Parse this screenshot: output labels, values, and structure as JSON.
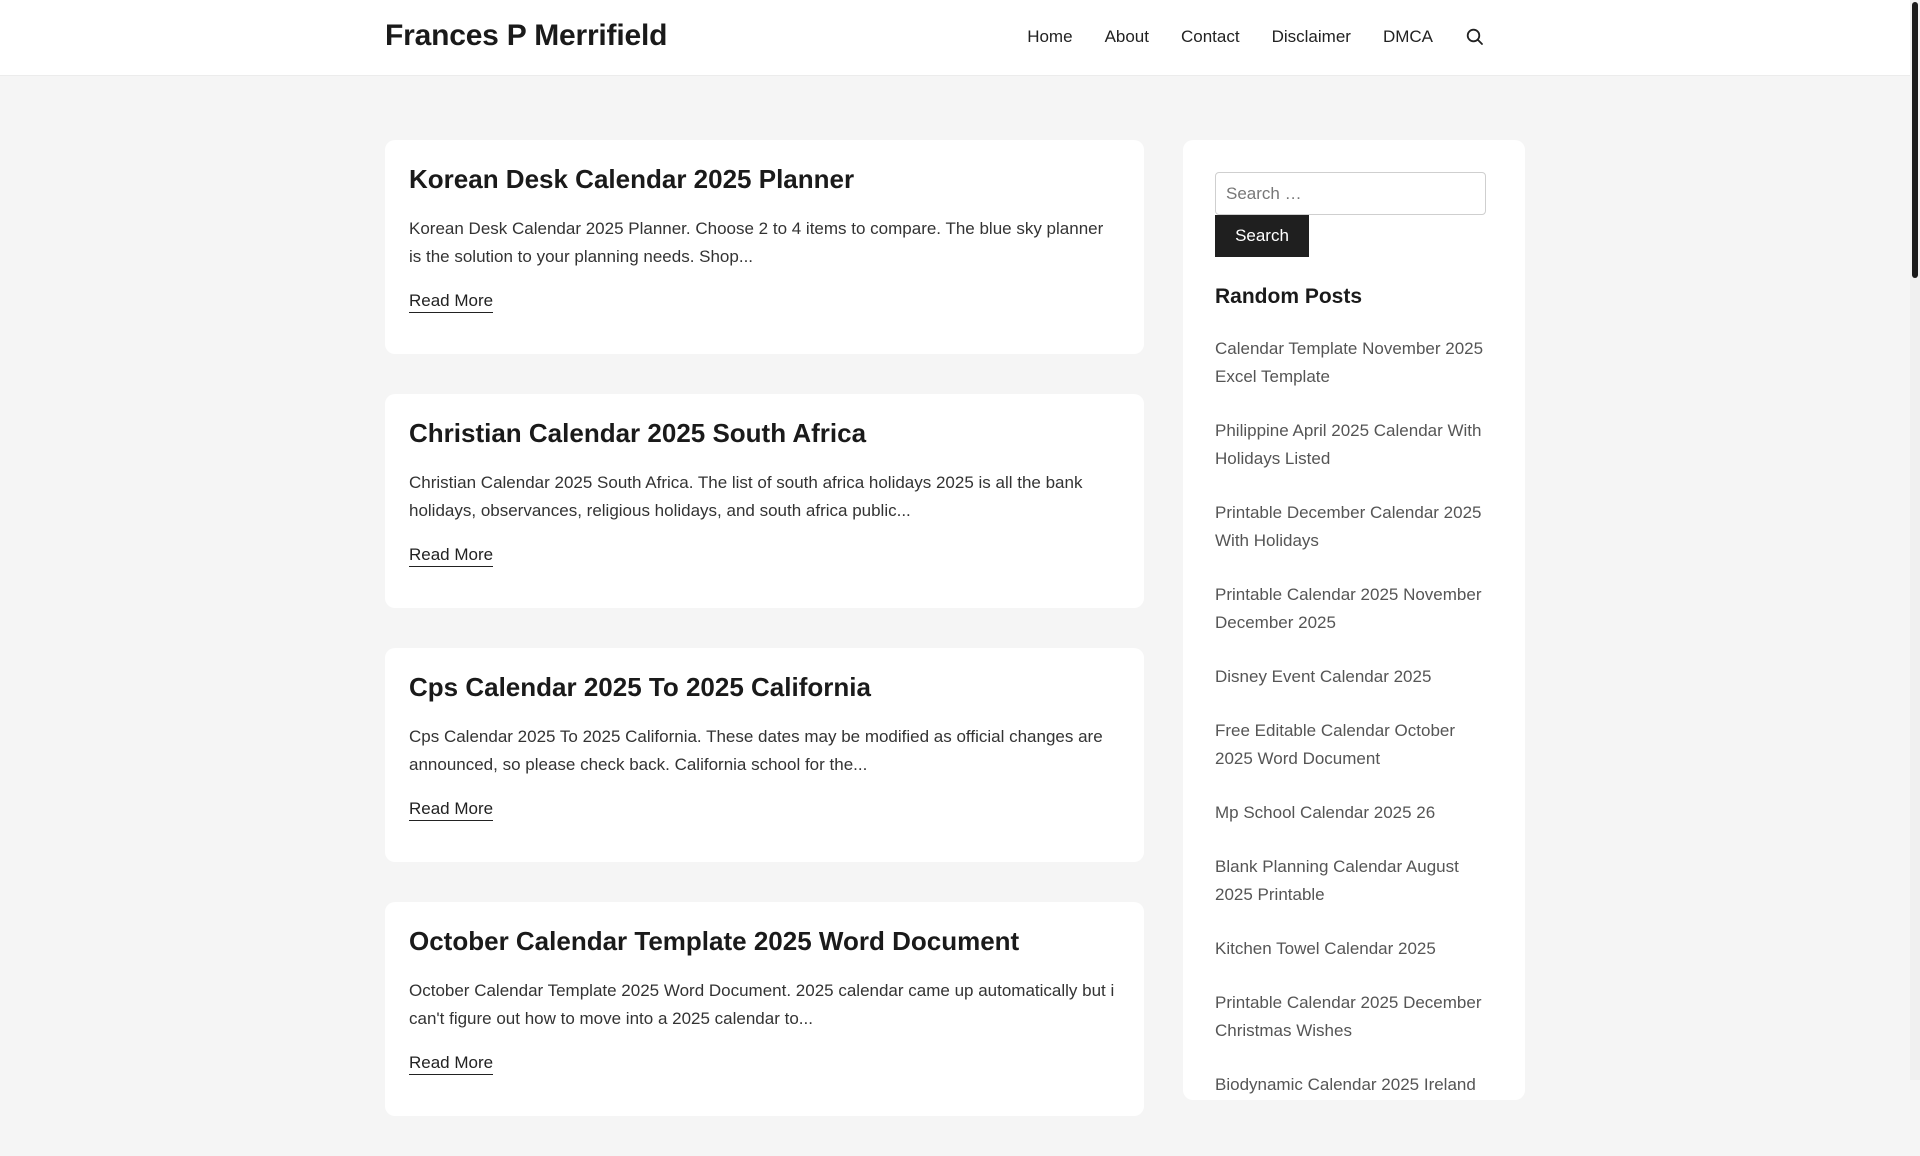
{
  "header": {
    "site_title": "Frances P Merrifield",
    "nav": [
      "Home",
      "About",
      "Contact",
      "Disclaimer",
      "DMCA"
    ]
  },
  "posts": [
    {
      "title": "Korean Desk Calendar 2025 Planner",
      "excerpt": "Korean Desk Calendar 2025 Planner. Choose 2 to 4 items to compare. The blue sky planner is the solution to your planning needs. Shop...",
      "read_more": "Read More"
    },
    {
      "title": "Christian Calendar 2025 South Africa",
      "excerpt": "Christian Calendar 2025 South Africa. The list of south africa holidays 2025 is all the bank holidays, observances, religious holidays, and south africa public...",
      "read_more": "Read More"
    },
    {
      "title": "Cps Calendar 2025 To 2025 California",
      "excerpt": "Cps Calendar 2025 To 2025 California. These dates may be modified as official changes are announced, so please check back. California school for the...",
      "read_more": "Read More"
    },
    {
      "title": "October Calendar Template 2025 Word Document",
      "excerpt": "October Calendar Template 2025 Word Document. 2025 calendar came up automatically but i can't figure out how to move into a 2025 calendar to...",
      "read_more": "Read More"
    }
  ],
  "sidebar": {
    "search_placeholder": "Search …",
    "search_button": "Search",
    "widget_title": "Random Posts",
    "random_posts": [
      "Calendar Template November 2025 Excel Template",
      "Philippine April 2025 Calendar With Holidays Listed",
      "Printable December Calendar 2025 With Holidays",
      "Printable Calendar 2025 November December 2025",
      "Disney Event Calendar 2025",
      "Free Editable Calendar October 2025 Word Document",
      "Mp School Calendar 2025 26",
      "Blank Planning Calendar August 2025 Printable",
      "Kitchen Towel Calendar 2025",
      "Printable Calendar 2025 December Christmas Wishes",
      "Biodynamic Calendar 2025 Ireland"
    ]
  },
  "icons": {
    "search": "search-icon"
  }
}
